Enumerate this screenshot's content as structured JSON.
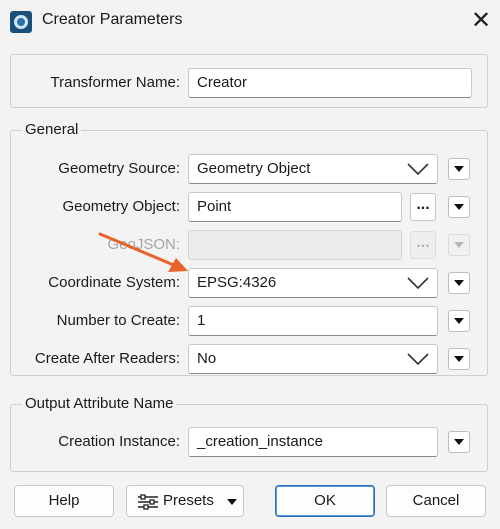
{
  "window": {
    "title": "Creator Parameters",
    "icon": "fme-creator-icon",
    "close_glyph": "✕"
  },
  "transformer_name": {
    "label": "Transformer Name:",
    "value": "Creator"
  },
  "general": {
    "title": "General",
    "geometry_source": {
      "label": "Geometry Source:",
      "value": "Geometry Object"
    },
    "geometry_object": {
      "label": "Geometry Object:",
      "value": "Point",
      "ellipsis": "..."
    },
    "geojson": {
      "label": "GeoJSON:",
      "value": "",
      "ellipsis": "..."
    },
    "coordinate_system": {
      "label": "Coordinate System:",
      "value": "EPSG:4326"
    },
    "number_to_create": {
      "label": "Number to Create:",
      "value": "1"
    },
    "create_after_readers": {
      "label": "Create After Readers:",
      "value": "No"
    }
  },
  "output": {
    "title": "Output Attribute Name",
    "creation_instance": {
      "label": "Creation Instance:",
      "value": "_creation_instance"
    }
  },
  "footer": {
    "help": "Help",
    "presets": "Presets",
    "ok": "OK",
    "cancel": "Cancel"
  },
  "colors": {
    "annotation_arrow": "#e8622a",
    "ok_border": "#2d6fb8"
  }
}
